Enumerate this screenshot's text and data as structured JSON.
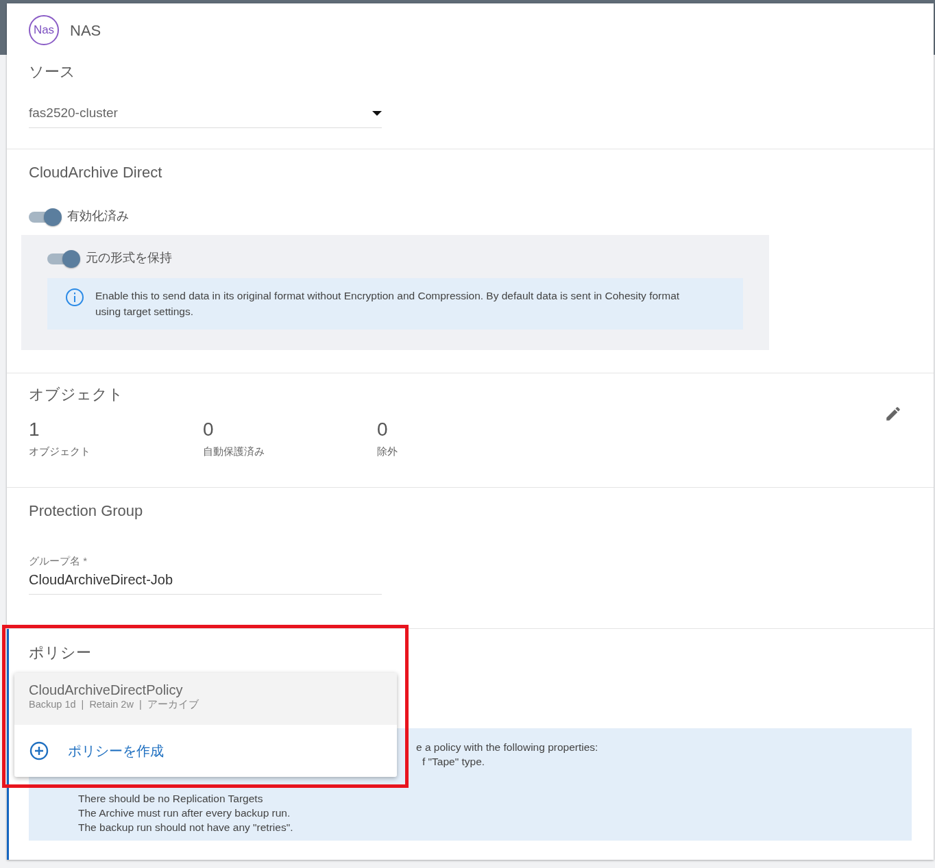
{
  "header": {
    "badge": "Nas",
    "title": "NAS"
  },
  "source": {
    "heading": "ソース",
    "value": "fas2520-cluster"
  },
  "cloud_archive": {
    "heading": "CloudArchive Direct",
    "toggle": {
      "label": "有効化済み",
      "on": true
    },
    "sub_toggle": {
      "label": "元の形式を保持",
      "on": true
    },
    "info": "Enable this to send data in its original format without Encryption and Compression. By default data is sent in Cohesity format using target settings."
  },
  "objects": {
    "heading": "オブジェクト",
    "stats": [
      {
        "value": "1",
        "label": "オブジェクト"
      },
      {
        "value": "0",
        "label": "自動保護済み"
      },
      {
        "value": "0",
        "label": "除外"
      }
    ]
  },
  "protection_group": {
    "heading": "Protection Group",
    "field": {
      "label": "グループ名 *",
      "value": "CloudArchiveDirect-Job"
    }
  },
  "policy": {
    "heading": "ポリシー",
    "menu": [
      {
        "kind": "option",
        "name": "CloudArchiveDirectPolicy",
        "details": "Backup 1d  |  Retain 2w  |  アーカイブ",
        "selected": true
      },
      {
        "kind": "action",
        "label": "ポリシーを作成",
        "selected": false
      }
    ],
    "info_partial": [
      "e a policy with the following properties:",
      "f \"Tape\" type."
    ],
    "info_lines": [
      "There should be no Replication Targets",
      "The Archive must run after every backup run.",
      "The backup run should not have any \"retries\"."
    ]
  }
}
